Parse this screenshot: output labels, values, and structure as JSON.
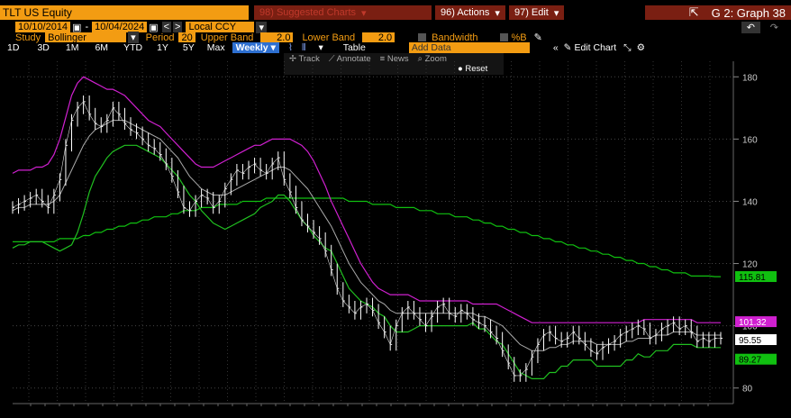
{
  "header": {
    "ticker": "TLT US Equity",
    "suggested_charts": "98) Suggested Charts",
    "actions": "96) Actions",
    "edit": "97) Edit",
    "graph_title": "G 2: Graph 38"
  },
  "controls": {
    "start_date": "10/10/2014",
    "end_date": "10/04/2024",
    "currency": "Local CCY",
    "study_label": "Study",
    "study_value": "Bollinger",
    "period_label": "Period",
    "period_value": "20",
    "upper_band_label": "Upper Band",
    "upper_band_value": "2.0",
    "lower_band_label": "Lower Band",
    "lower_band_value": "2.0",
    "bandwidth_label": "Bandwidth",
    "percent_b_label": "%B"
  },
  "toolbar": {
    "ranges": [
      "1D",
      "3D",
      "1M",
      "6M",
      "YTD",
      "1Y",
      "5Y",
      "Max"
    ],
    "frequency": "Weekly",
    "table": "Table",
    "add_data": "Add Data",
    "edit_chart": "Edit Chart",
    "track": "Track",
    "annotate": "Annotate",
    "news": "News",
    "zoom": "Zoom",
    "reset": "Reset"
  },
  "colors": {
    "accent": "#f39c12",
    "upper_band": "#d020d0",
    "lower_band": "#20c020",
    "ma200": "#10c010",
    "price": "#ffffff"
  },
  "chart_data": {
    "type": "line",
    "ylim": [
      75,
      185
    ],
    "yticks": [
      80,
      100,
      120,
      140,
      160,
      180
    ],
    "grid": true,
    "x": [
      0,
      1,
      2,
      3,
      4,
      5,
      6,
      7,
      8,
      9,
      10,
      11,
      12,
      13,
      14,
      15,
      16,
      17,
      18,
      19,
      20,
      21,
      22,
      23,
      24,
      25,
      26,
      27,
      28,
      29,
      30,
      31,
      32,
      33,
      34,
      35,
      36,
      37,
      38,
      39,
      40,
      41,
      42,
      43,
      44,
      45,
      46,
      47,
      48,
      49,
      50,
      51,
      52,
      53,
      54,
      55,
      56,
      57,
      58,
      59,
      60,
      61,
      62,
      63,
      64,
      65,
      66,
      67,
      68,
      69,
      70,
      71,
      72,
      73,
      74,
      75,
      76,
      77,
      78,
      79,
      80,
      81,
      82,
      83,
      84,
      85,
      86,
      87,
      88,
      89,
      90,
      91,
      92,
      93,
      94,
      95,
      96,
      97,
      98,
      99,
      100,
      101,
      102,
      103,
      104,
      105,
      106,
      107,
      108,
      109,
      110,
      111,
      112,
      113,
      114,
      115,
      116,
      117,
      118,
      119,
      120
    ],
    "series": [
      {
        "key": "price",
        "values": [
          138,
          139,
          140,
          141,
          142,
          140,
          138,
          142,
          147,
          158,
          166,
          170,
          172,
          168,
          165,
          164,
          166,
          170,
          168,
          165,
          163,
          162,
          160,
          158,
          157,
          155,
          152,
          148,
          143,
          138,
          137,
          140,
          142,
          141,
          138,
          140,
          144,
          147,
          150,
          149,
          151,
          152,
          150,
          149,
          152,
          154,
          147,
          143,
          138,
          134,
          132,
          130,
          128,
          124,
          118,
          112,
          108,
          106,
          104,
          106,
          107,
          105,
          101,
          98,
          94,
          100,
          104,
          106,
          104,
          102,
          100,
          103,
          106,
          107,
          104,
          103,
          105,
          104,
          102,
          101,
          100,
          98,
          96,
          92,
          88,
          84,
          84,
          86,
          90,
          94,
          97,
          98,
          96,
          95,
          96,
          98,
          96,
          94,
          92,
          91,
          93,
          94,
          95,
          97,
          98,
          99,
          100,
          99,
          96,
          97,
          99,
          100,
          101,
          99,
          100,
          98,
          95,
          96,
          95,
          96,
          96
        ]
      },
      {
        "key": "ma20",
        "values": [
          137,
          138,
          138,
          139,
          139,
          139,
          139,
          140,
          142,
          146,
          150,
          154,
          158,
          161,
          163,
          164,
          165,
          166,
          166,
          166,
          165,
          164,
          163,
          162,
          161,
          160,
          158,
          156,
          154,
          151,
          148,
          146,
          144,
          143,
          142,
          142,
          142,
          143,
          144,
          145,
          146,
          147,
          148,
          149,
          150,
          151,
          151,
          150,
          148,
          146,
          144,
          141,
          138,
          135,
          132,
          128,
          124,
          120,
          117,
          114,
          112,
          110,
          108,
          107,
          105,
          104,
          104,
          104,
          104,
          104,
          104,
          104,
          104,
          104,
          104,
          104,
          104,
          104,
          104,
          103,
          103,
          102,
          101,
          100,
          98,
          96,
          94,
          93,
          92,
          92,
          92,
          93,
          93,
          94,
          94,
          95,
          95,
          95,
          95,
          94,
          94,
          94,
          94,
          94,
          95,
          95,
          96,
          96,
          96,
          97,
          97,
          97,
          98,
          98,
          98,
          98,
          97,
          97,
          97,
          97,
          97
        ]
      },
      {
        "key": "upper",
        "values": [
          149,
          150,
          150,
          150,
          151,
          151,
          152,
          155,
          160,
          167,
          174,
          178,
          180,
          179,
          178,
          177,
          176,
          176,
          175,
          174,
          172,
          170,
          168,
          166,
          165,
          164,
          162,
          160,
          158,
          156,
          154,
          152,
          151,
          151,
          151,
          152,
          153,
          154,
          155,
          156,
          157,
          158,
          158,
          159,
          160,
          160,
          160,
          160,
          159,
          158,
          156,
          153,
          149,
          145,
          140,
          136,
          132,
          128,
          124,
          120,
          117,
          114,
          112,
          111,
          110,
          110,
          110,
          110,
          109,
          108,
          108,
          108,
          108,
          108,
          108,
          108,
          108,
          108,
          107,
          107,
          107,
          107,
          107,
          106,
          105,
          104,
          103,
          102,
          101,
          101,
          101,
          101,
          101,
          101,
          101,
          101,
          101,
          101,
          101,
          101,
          101,
          101,
          101,
          101,
          101,
          101,
          101,
          102,
          102,
          102,
          102,
          102,
          102,
          102,
          102,
          102,
          101,
          101,
          101,
          101,
          101
        ]
      },
      {
        "key": "lower",
        "values": [
          125,
          126,
          126,
          127,
          127,
          127,
          126,
          125,
          124,
          125,
          126,
          130,
          136,
          143,
          148,
          151,
          154,
          156,
          157,
          158,
          158,
          158,
          157,
          156,
          155,
          154,
          152,
          150,
          148,
          145,
          142,
          140,
          137,
          135,
          133,
          132,
          131,
          132,
          133,
          134,
          135,
          136,
          138,
          139,
          140,
          142,
          142,
          140,
          137,
          134,
          132,
          129,
          127,
          125,
          124,
          120,
          116,
          112,
          110,
          108,
          107,
          106,
          104,
          103,
          100,
          98,
          98,
          98,
          99,
          100,
          100,
          100,
          100,
          100,
          100,
          100,
          100,
          100,
          101,
          99,
          99,
          97,
          95,
          94,
          91,
          88,
          85,
          84,
          83,
          83,
          83,
          85,
          85,
          87,
          87,
          89,
          89,
          89,
          89,
          87,
          87,
          87,
          87,
          87,
          89,
          89,
          91,
          90,
          90,
          92,
          92,
          92,
          94,
          94,
          94,
          94,
          93,
          93,
          93,
          93,
          93
        ]
      },
      {
        "key": "ma200",
        "values": [
          127,
          127,
          127,
          127,
          127,
          127,
          127,
          127,
          128,
          128,
          128,
          128,
          129,
          129,
          130,
          130,
          131,
          131,
          132,
          132,
          133,
          133,
          134,
          134,
          135,
          135,
          135,
          136,
          136,
          137,
          137,
          137,
          138,
          138,
          138,
          139,
          139,
          139,
          139,
          140,
          140,
          140,
          140,
          141,
          141,
          141,
          141,
          141,
          141,
          141,
          141,
          141,
          141,
          141,
          141,
          141,
          141,
          140,
          140,
          140,
          140,
          139,
          139,
          139,
          139,
          138,
          138,
          138,
          138,
          137,
          137,
          137,
          136,
          136,
          136,
          135,
          135,
          135,
          134,
          134,
          133,
          133,
          132,
          132,
          131,
          131,
          130,
          130,
          129,
          129,
          128,
          128,
          127,
          127,
          126,
          126,
          125,
          125,
          124,
          124,
          123,
          123,
          122,
          122,
          121,
          121,
          120,
          120,
          119,
          119,
          118,
          118,
          117,
          117,
          117,
          116,
          116,
          116,
          116,
          115.8,
          115.8
        ]
      }
    ],
    "last_values": [
      {
        "label": "115.81",
        "value": 115.81,
        "color": "#10c010",
        "text": "#000"
      },
      {
        "label": "101.32",
        "value": 101.32,
        "color": "#d020d0",
        "text": "#fff"
      },
      {
        "label": "95.55",
        "value": 95.55,
        "color": "#ffffff",
        "text": "#000"
      },
      {
        "label": "89.27",
        "value": 89.27,
        "color": "#10c010",
        "text": "#000"
      }
    ]
  }
}
